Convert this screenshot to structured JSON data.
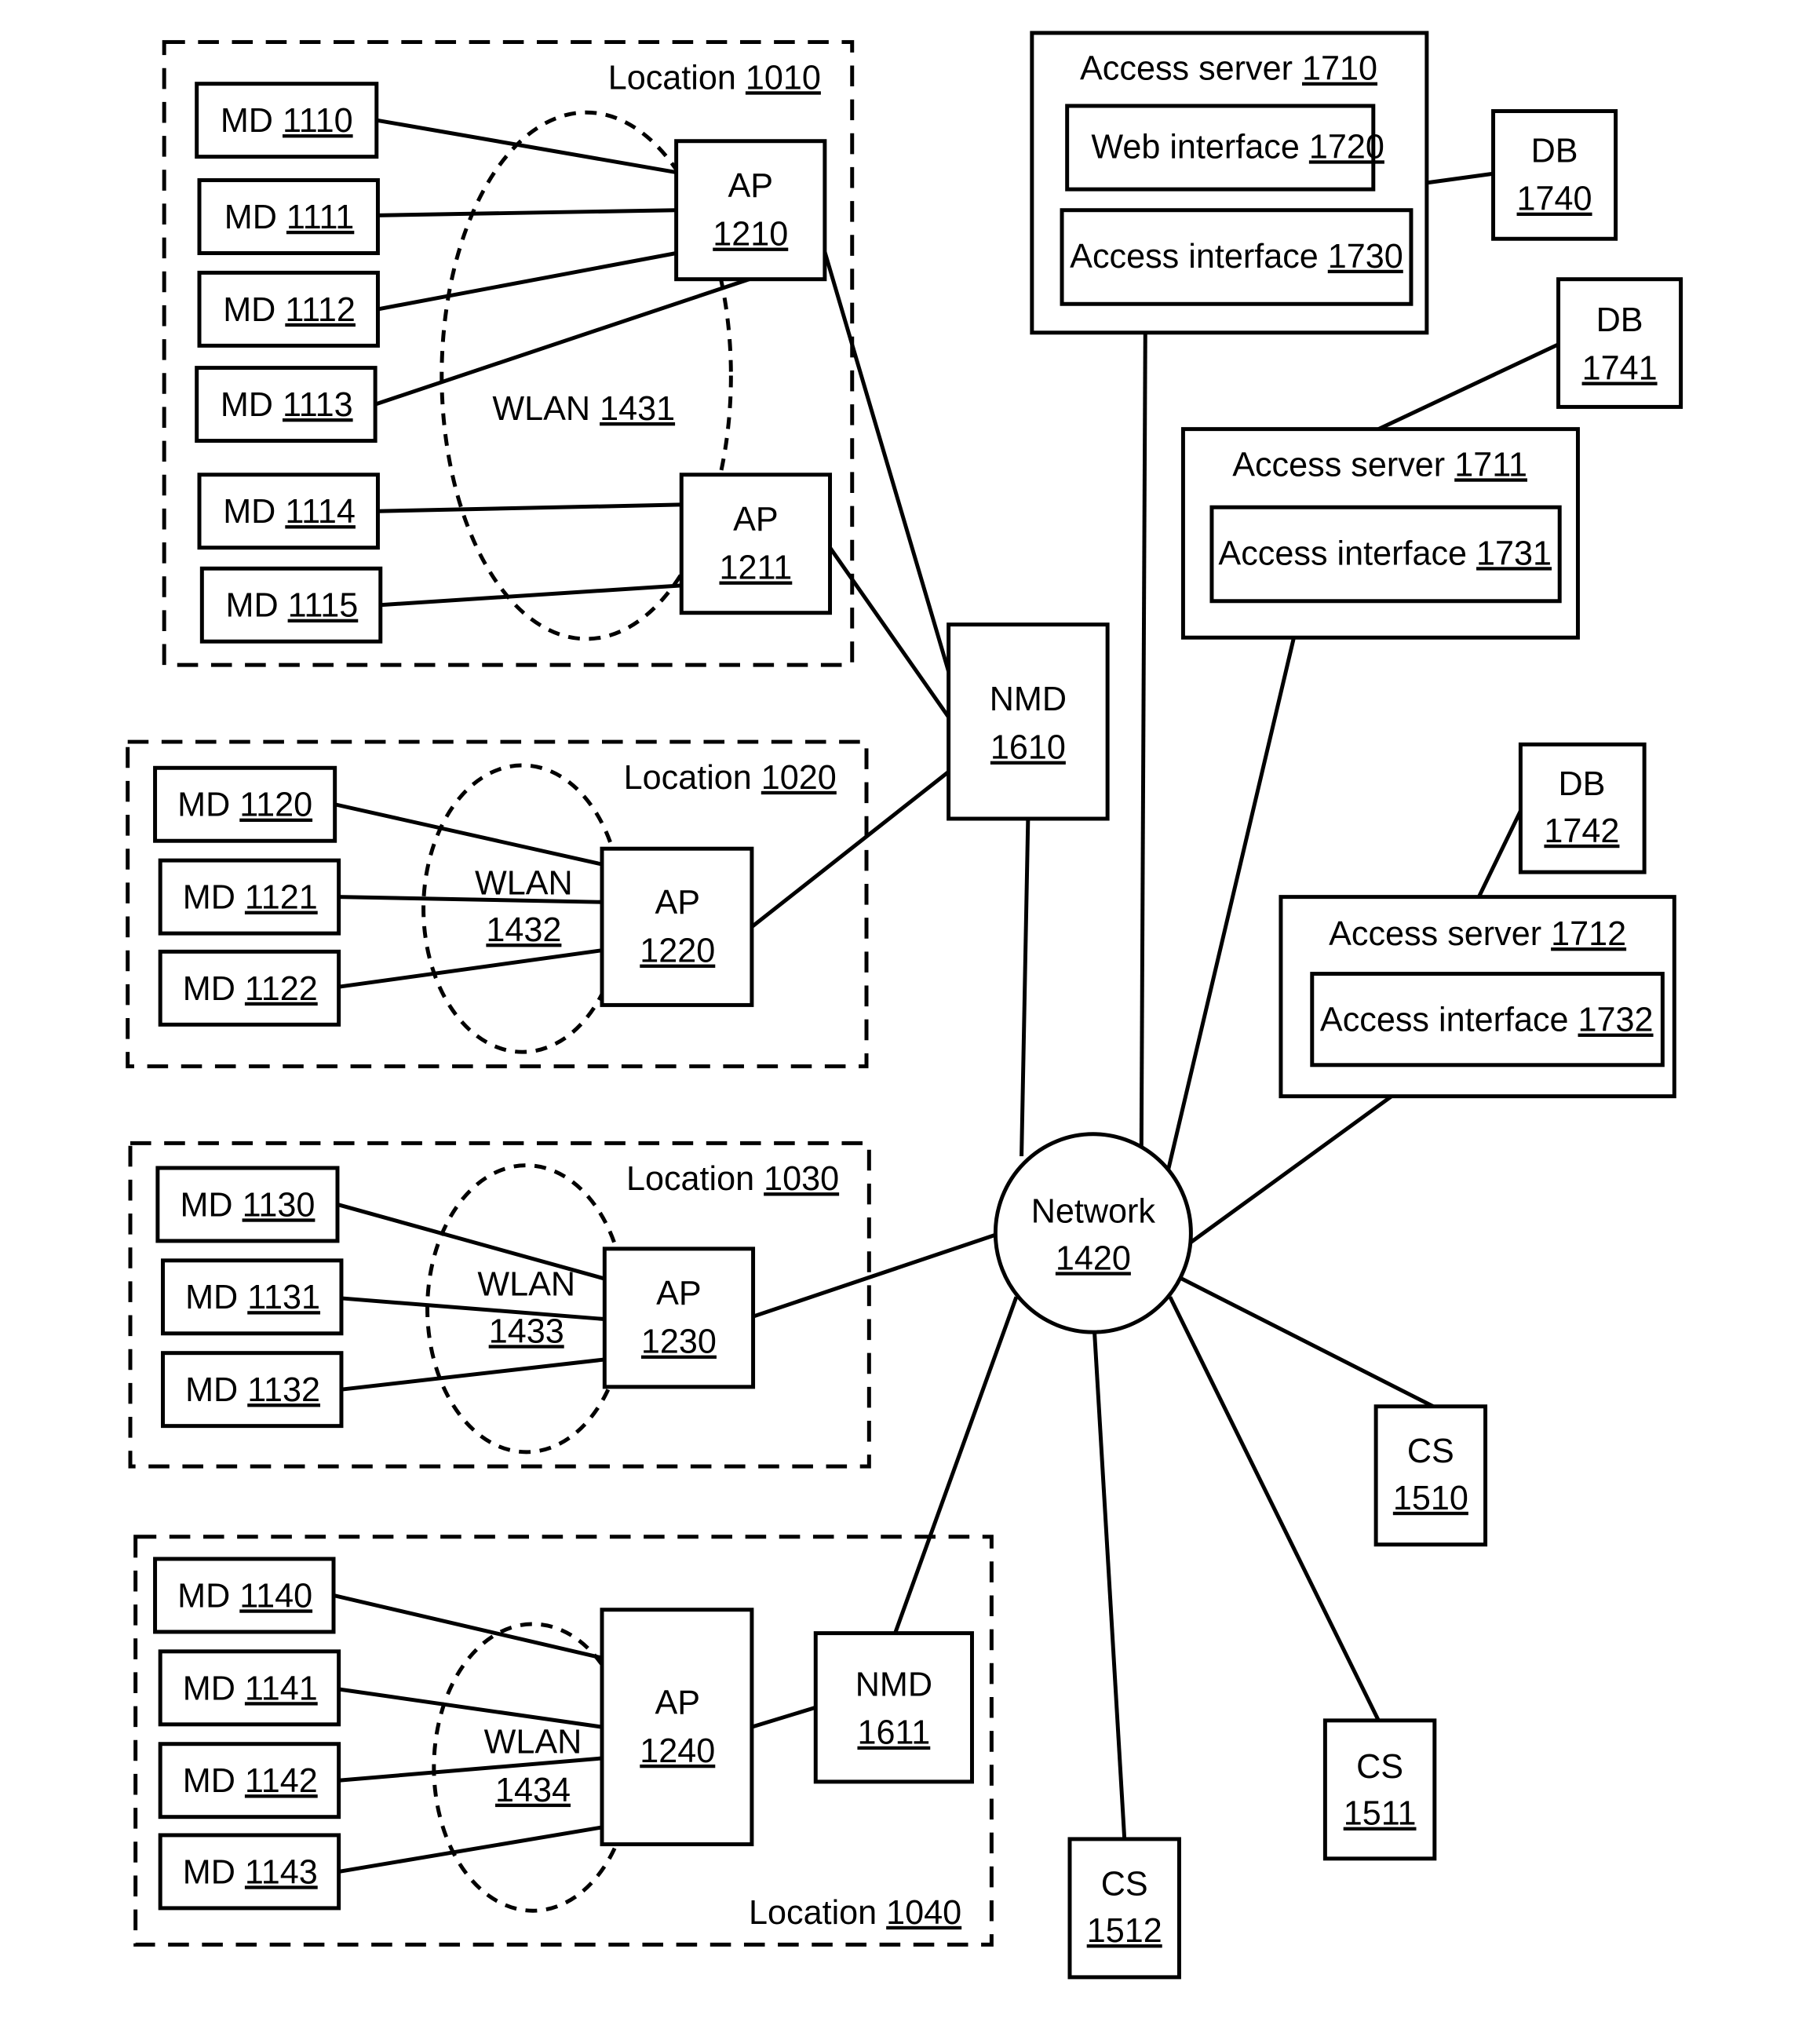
{
  "locations": [
    {
      "id": "loc1010",
      "label": "Location",
      "num": "1010"
    },
    {
      "id": "loc1020",
      "label": "Location",
      "num": "1020"
    },
    {
      "id": "loc1030",
      "label": "Location",
      "num": "1030"
    },
    {
      "id": "loc1040",
      "label": "Location",
      "num": "1040"
    }
  ],
  "wlans": [
    {
      "label": "WLAN",
      "num": "1431"
    },
    {
      "label": "WLAN",
      "num": "1432"
    },
    {
      "label": "WLAN",
      "num": "1433"
    },
    {
      "label": "WLAN",
      "num": "1434"
    }
  ],
  "mobile_devices": [
    {
      "label": "MD",
      "num": "1110"
    },
    {
      "label": "MD",
      "num": "1111"
    },
    {
      "label": "MD",
      "num": "1112"
    },
    {
      "label": "MD",
      "num": "1113"
    },
    {
      "label": "MD",
      "num": "1114"
    },
    {
      "label": "MD",
      "num": "1115"
    },
    {
      "label": "MD",
      "num": "1120"
    },
    {
      "label": "MD",
      "num": "1121"
    },
    {
      "label": "MD",
      "num": "1122"
    },
    {
      "label": "MD",
      "num": "1130"
    },
    {
      "label": "MD",
      "num": "1131"
    },
    {
      "label": "MD",
      "num": "1132"
    },
    {
      "label": "MD",
      "num": "1140"
    },
    {
      "label": "MD",
      "num": "1141"
    },
    {
      "label": "MD",
      "num": "1142"
    },
    {
      "label": "MD",
      "num": "1143"
    }
  ],
  "access_points": [
    {
      "label": "AP",
      "num": "1210"
    },
    {
      "label": "AP",
      "num": "1211"
    },
    {
      "label": "AP",
      "num": "1220"
    },
    {
      "label": "AP",
      "num": "1230"
    },
    {
      "label": "AP",
      "num": "1240"
    }
  ],
  "nmds": [
    {
      "label": "NMD",
      "num": "1610"
    },
    {
      "label": "NMD",
      "num": "1611"
    }
  ],
  "network": {
    "label": "Network",
    "num": "1420"
  },
  "access_servers": [
    {
      "label": "Access server",
      "num": "1710",
      "web_interface": {
        "label": "Web interface",
        "num": "1720"
      },
      "access_interface": {
        "label": "Access interface",
        "num": "1730"
      }
    },
    {
      "label": "Access server",
      "num": "1711",
      "access_interface": {
        "label": "Access interface",
        "num": "1731"
      }
    },
    {
      "label": "Access server",
      "num": "1712",
      "access_interface": {
        "label": "Access interface",
        "num": "1732"
      }
    }
  ],
  "databases": [
    {
      "label": "DB",
      "num": "1740"
    },
    {
      "label": "DB",
      "num": "1741"
    },
    {
      "label": "DB",
      "num": "1742"
    }
  ],
  "client_servers": [
    {
      "label": "CS",
      "num": "1510"
    },
    {
      "label": "CS",
      "num": "1511"
    },
    {
      "label": "CS",
      "num": "1512"
    }
  ]
}
